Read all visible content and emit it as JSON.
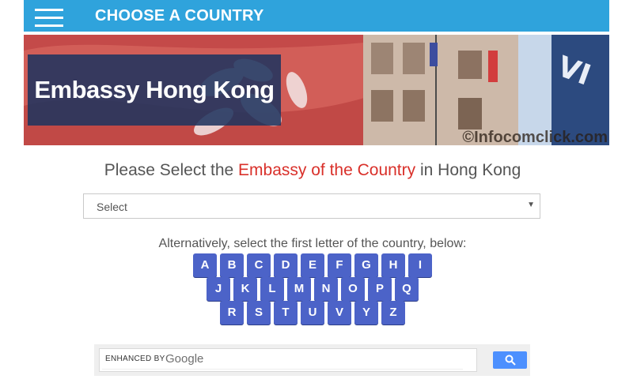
{
  "topbar": {
    "title": "CHOOSE A COUNTRY"
  },
  "banner": {
    "caption": "Embassy Hong Kong",
    "watermark": "©Infocomclick.com"
  },
  "heading": {
    "prefix": "Please Select the",
    "accent": "Embassy of the Country",
    "suffix": "in Hong Kong"
  },
  "select": {
    "value": "Select"
  },
  "alphabet": {
    "intro": "Alternatively, select the first letter of the country, below:",
    "rows": [
      [
        "A",
        "B",
        "C",
        "D",
        "E",
        "F",
        "G",
        "H",
        "I"
      ],
      [
        "J",
        "K",
        "L",
        "M",
        "N",
        "O",
        "P",
        "Q"
      ],
      [
        "R",
        "S",
        "T",
        "U",
        "V",
        "Y",
        "Z"
      ]
    ]
  },
  "search": {
    "placeholder": "ENHANCED BY",
    "brand": "Google"
  },
  "colors": {
    "topbar": "#2fa3dc",
    "letter_button": "#4c63c8",
    "accent_text": "#d9302a",
    "search_button": "#4d90fe"
  }
}
